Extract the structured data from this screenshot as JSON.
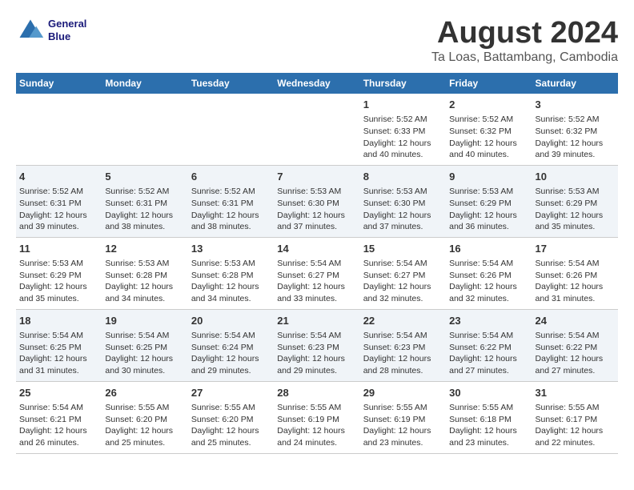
{
  "logo": {
    "line1": "General",
    "line2": "Blue"
  },
  "title": "August 2024",
  "subtitle": "Ta Loas, Battambang, Cambodia",
  "days_header": [
    "Sunday",
    "Monday",
    "Tuesday",
    "Wednesday",
    "Thursday",
    "Friday",
    "Saturday"
  ],
  "rows": [
    [
      {
        "day": "",
        "content": ""
      },
      {
        "day": "",
        "content": ""
      },
      {
        "day": "",
        "content": ""
      },
      {
        "day": "",
        "content": ""
      },
      {
        "day": "1",
        "content": "Sunrise: 5:52 AM\nSunset: 6:33 PM\nDaylight: 12 hours\nand 40 minutes."
      },
      {
        "day": "2",
        "content": "Sunrise: 5:52 AM\nSunset: 6:32 PM\nDaylight: 12 hours\nand 40 minutes."
      },
      {
        "day": "3",
        "content": "Sunrise: 5:52 AM\nSunset: 6:32 PM\nDaylight: 12 hours\nand 39 minutes."
      }
    ],
    [
      {
        "day": "4",
        "content": "Sunrise: 5:52 AM\nSunset: 6:31 PM\nDaylight: 12 hours\nand 39 minutes."
      },
      {
        "day": "5",
        "content": "Sunrise: 5:52 AM\nSunset: 6:31 PM\nDaylight: 12 hours\nand 38 minutes."
      },
      {
        "day": "6",
        "content": "Sunrise: 5:52 AM\nSunset: 6:31 PM\nDaylight: 12 hours\nand 38 minutes."
      },
      {
        "day": "7",
        "content": "Sunrise: 5:53 AM\nSunset: 6:30 PM\nDaylight: 12 hours\nand 37 minutes."
      },
      {
        "day": "8",
        "content": "Sunrise: 5:53 AM\nSunset: 6:30 PM\nDaylight: 12 hours\nand 37 minutes."
      },
      {
        "day": "9",
        "content": "Sunrise: 5:53 AM\nSunset: 6:29 PM\nDaylight: 12 hours\nand 36 minutes."
      },
      {
        "day": "10",
        "content": "Sunrise: 5:53 AM\nSunset: 6:29 PM\nDaylight: 12 hours\nand 35 minutes."
      }
    ],
    [
      {
        "day": "11",
        "content": "Sunrise: 5:53 AM\nSunset: 6:29 PM\nDaylight: 12 hours\nand 35 minutes."
      },
      {
        "day": "12",
        "content": "Sunrise: 5:53 AM\nSunset: 6:28 PM\nDaylight: 12 hours\nand 34 minutes."
      },
      {
        "day": "13",
        "content": "Sunrise: 5:53 AM\nSunset: 6:28 PM\nDaylight: 12 hours\nand 34 minutes."
      },
      {
        "day": "14",
        "content": "Sunrise: 5:54 AM\nSunset: 6:27 PM\nDaylight: 12 hours\nand 33 minutes."
      },
      {
        "day": "15",
        "content": "Sunrise: 5:54 AM\nSunset: 6:27 PM\nDaylight: 12 hours\nand 32 minutes."
      },
      {
        "day": "16",
        "content": "Sunrise: 5:54 AM\nSunset: 6:26 PM\nDaylight: 12 hours\nand 32 minutes."
      },
      {
        "day": "17",
        "content": "Sunrise: 5:54 AM\nSunset: 6:26 PM\nDaylight: 12 hours\nand 31 minutes."
      }
    ],
    [
      {
        "day": "18",
        "content": "Sunrise: 5:54 AM\nSunset: 6:25 PM\nDaylight: 12 hours\nand 31 minutes."
      },
      {
        "day": "19",
        "content": "Sunrise: 5:54 AM\nSunset: 6:25 PM\nDaylight: 12 hours\nand 30 minutes."
      },
      {
        "day": "20",
        "content": "Sunrise: 5:54 AM\nSunset: 6:24 PM\nDaylight: 12 hours\nand 29 minutes."
      },
      {
        "day": "21",
        "content": "Sunrise: 5:54 AM\nSunset: 6:23 PM\nDaylight: 12 hours\nand 29 minutes."
      },
      {
        "day": "22",
        "content": "Sunrise: 5:54 AM\nSunset: 6:23 PM\nDaylight: 12 hours\nand 28 minutes."
      },
      {
        "day": "23",
        "content": "Sunrise: 5:54 AM\nSunset: 6:22 PM\nDaylight: 12 hours\nand 27 minutes."
      },
      {
        "day": "24",
        "content": "Sunrise: 5:54 AM\nSunset: 6:22 PM\nDaylight: 12 hours\nand 27 minutes."
      }
    ],
    [
      {
        "day": "25",
        "content": "Sunrise: 5:54 AM\nSunset: 6:21 PM\nDaylight: 12 hours\nand 26 minutes."
      },
      {
        "day": "26",
        "content": "Sunrise: 5:55 AM\nSunset: 6:20 PM\nDaylight: 12 hours\nand 25 minutes."
      },
      {
        "day": "27",
        "content": "Sunrise: 5:55 AM\nSunset: 6:20 PM\nDaylight: 12 hours\nand 25 minutes."
      },
      {
        "day": "28",
        "content": "Sunrise: 5:55 AM\nSunset: 6:19 PM\nDaylight: 12 hours\nand 24 minutes."
      },
      {
        "day": "29",
        "content": "Sunrise: 5:55 AM\nSunset: 6:19 PM\nDaylight: 12 hours\nand 23 minutes."
      },
      {
        "day": "30",
        "content": "Sunrise: 5:55 AM\nSunset: 6:18 PM\nDaylight: 12 hours\nand 23 minutes."
      },
      {
        "day": "31",
        "content": "Sunrise: 5:55 AM\nSunset: 6:17 PM\nDaylight: 12 hours\nand 22 minutes."
      }
    ]
  ]
}
